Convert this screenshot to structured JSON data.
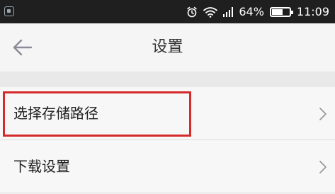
{
  "status_bar": {
    "battery_percent_text": "64%",
    "battery_level": 0.64,
    "time": "11:09",
    "icons": [
      "gallery-notification-icon",
      "alarm-icon",
      "wifi-icon",
      "signal-icon",
      "battery-icon"
    ]
  },
  "header": {
    "title": "设置",
    "back_icon": "back-arrow-icon"
  },
  "settings": {
    "items": [
      {
        "label": "选择存储路径",
        "icon": "chevron-right-icon",
        "highlighted": true
      },
      {
        "label": "下载设置",
        "icon": "chevron-right-icon",
        "highlighted": false
      }
    ]
  },
  "colors": {
    "status_bar_bg": "#1f1f1f",
    "app_bar_bg": "#f5f5f5",
    "highlight": "#d42a2a",
    "chevron": "#9a9a9a"
  }
}
